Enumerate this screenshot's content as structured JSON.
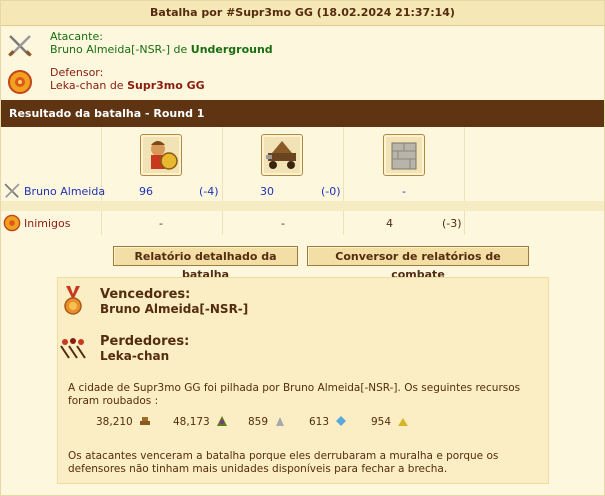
{
  "header": {
    "title": "Batalha por #Supr3mo GG (18.02.2024 21:37:14)"
  },
  "attacker": {
    "label": "Atacante:",
    "player": "Bruno Almeida[-NSR-]",
    "connector": "de",
    "city": "Underground",
    "icon": "crossed-swords-icon"
  },
  "defender": {
    "label": "Defensor:",
    "player": "Leka-chan",
    "connector": "de",
    "city": "Supr3mo GG",
    "icon": "shield-icon"
  },
  "result": {
    "title": "Resultado da batalha - Round 1",
    "units": [
      {
        "name": "hoplite-unit-icon"
      },
      {
        "name": "ram-unit-icon"
      },
      {
        "name": "wall-unit-icon"
      }
    ],
    "attacker_row": {
      "label": "Bruno Almeida",
      "cells": [
        {
          "value": "96",
          "loss": "(-4)"
        },
        {
          "value": "30",
          "loss": "(-0)"
        },
        {
          "value": "-",
          "loss": ""
        }
      ]
    },
    "defender_row": {
      "label": "Inimigos",
      "cells": [
        {
          "value": "-",
          "loss": ""
        },
        {
          "value": "-",
          "loss": ""
        },
        {
          "value": "4",
          "loss": "(-3)"
        }
      ]
    }
  },
  "buttons": {
    "detailed_report": "Relatório detalhado da batalha",
    "converter": "Conversor de relatórios de combate"
  },
  "summary": {
    "winners_label": "Vencedores:",
    "winners_name": "Bruno Almeida[-NSR-]",
    "losers_label": "Perdedores:",
    "losers_name": "Leka-chan",
    "loot_text": "A cidade de Supr3mo GG foi pilhada por Bruno Almeida[-NSR-]. Os seguintes recursos foram roubados :",
    "resources": [
      {
        "amount": "38,210",
        "icon": "wood-icon",
        "color": "#8a5a22"
      },
      {
        "amount": "48,173",
        "icon": "wine-icon",
        "color": "#5c7a1e"
      },
      {
        "amount": "859",
        "icon": "marble-icon",
        "color": "#a8a8a8"
      },
      {
        "amount": "613",
        "icon": "crystal-icon",
        "color": "#5aa9d8"
      },
      {
        "amount": "954",
        "icon": "sulfur-icon",
        "color": "#d7b52a"
      }
    ],
    "reason_text": "Os atacantes venceram a batalha porque eles derrubaram a muralha e porque os defensores não tinham mais unidades disponíveis para fechar a brecha."
  },
  "colors": {
    "attacker": "#1a6e12",
    "defender": "#8a1c10",
    "result_bar": "#5e3413",
    "link": "#1f32b8"
  }
}
